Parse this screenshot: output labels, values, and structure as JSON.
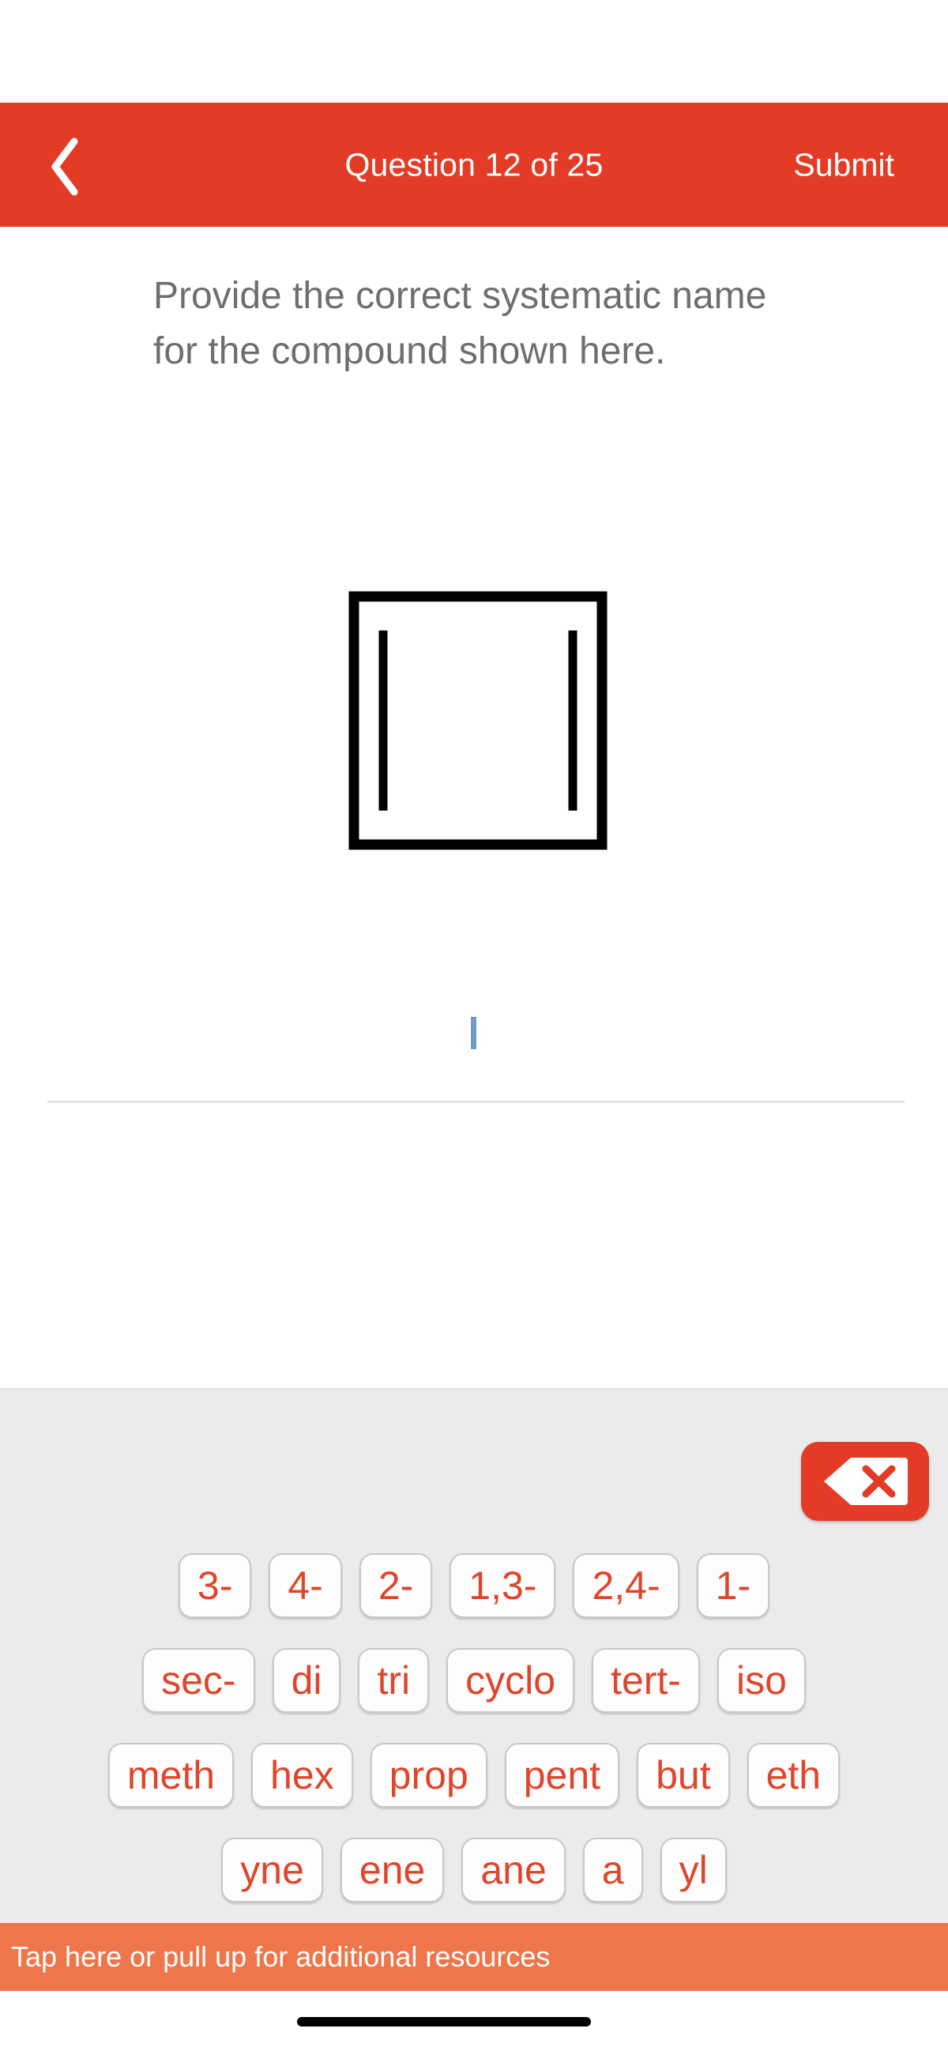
{
  "app": {
    "accent_red": "#E33B26",
    "accent_orange": "#EF764A",
    "key_text_color": "#E0452C",
    "keyboard_bg": "#EBEBEB",
    "caret_color": "#6F9BC6"
  },
  "navbar": {
    "back_icon": "chevron-left-icon",
    "title": "Question 12 of 25",
    "submit_label": "Submit"
  },
  "question": {
    "prompt": "Provide the correct systematic name for the compound shown here.",
    "structure": {
      "name": "cyclobutadiene-skeletal-structure",
      "description": "Square ring with two inner parallel bond lines (left and right sides) indicating two double bonds",
      "ring_sides": 4,
      "inner_double_bond_lines": 2,
      "line_color": "#000000"
    }
  },
  "answer": {
    "value": "",
    "placeholder": "",
    "caret_visible": true
  },
  "keyboard": {
    "backspace": {
      "icon": "backspace-delete-icon",
      "label": ""
    },
    "rows": [
      {
        "keys": [
          "3-",
          "4-",
          "2-",
          "1,3-",
          "2,4-",
          "1-"
        ]
      },
      {
        "keys": [
          "sec-",
          "di",
          "tri",
          "cyclo",
          "tert-",
          "iso"
        ]
      },
      {
        "keys": [
          "meth",
          "hex",
          "prop",
          "pent",
          "but",
          "eth"
        ]
      },
      {
        "keys": [
          "yne",
          "ene",
          "ane",
          "a",
          "yl"
        ]
      }
    ]
  },
  "resources_bar": {
    "label": "Tap here or pull up for additional resources"
  },
  "system": {
    "home_indicator": true
  }
}
